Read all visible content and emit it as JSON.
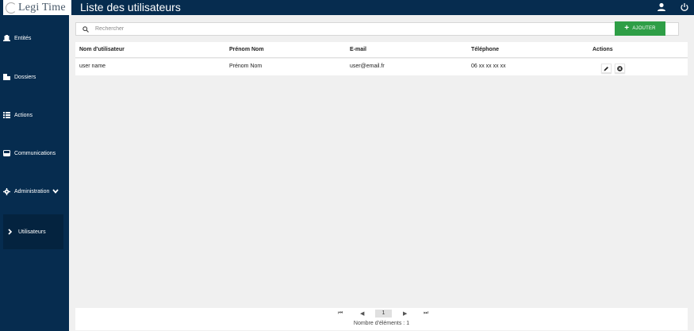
{
  "app": {
    "logo_text": "Legi Time"
  },
  "header": {
    "title": "Liste des utilisateurs"
  },
  "sidebar": {
    "items": [
      {
        "label": "Entités",
        "icon": "building-icon"
      },
      {
        "label": "Dossiers",
        "icon": "files-icon"
      },
      {
        "label": "Actions",
        "icon": "list-icon"
      },
      {
        "label": "Communications",
        "icon": "inbox-icon"
      },
      {
        "label": "Administration",
        "icon": "gear-icon"
      }
    ],
    "sub_items": [
      {
        "label": "Utilisateurs",
        "icon": "chevron-right-icon"
      }
    ]
  },
  "search": {
    "placeholder": "Rechercher",
    "value": ""
  },
  "toolbar": {
    "add_label": "AJOUTER"
  },
  "table": {
    "headers": [
      "Nom d'utilisateur",
      "Prénom Nom",
      "E-mail",
      "Téléphone",
      "Actions"
    ],
    "rows": [
      [
        "user name",
        "Prénom Nom",
        "user@email.fr",
        "06 xx xx xx xx"
      ]
    ]
  },
  "pagination": {
    "current_page": "1",
    "count_label": "Nombre d'éléments : 1"
  },
  "colors": {
    "navy": "#062c4f",
    "green": "#2e9e46",
    "background": "#f0f0f0"
  }
}
